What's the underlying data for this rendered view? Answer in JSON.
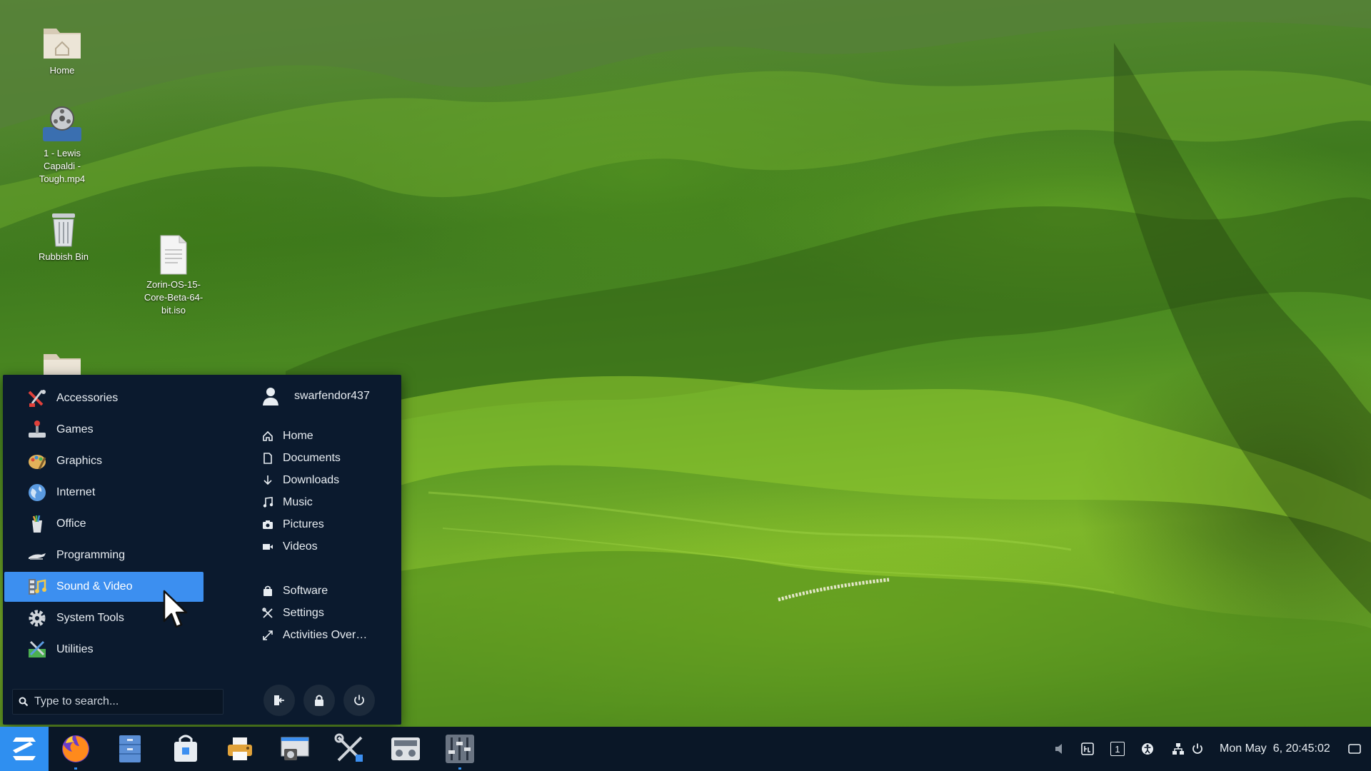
{
  "desktop": {
    "icons": [
      {
        "label": "Home",
        "icon": "home-folder-icon"
      },
      {
        "label": "1 - Lewis Capaldi - Tough.mp4",
        "icon": "video-file-icon"
      },
      {
        "label": "Rubbish Bin",
        "icon": "trash-icon"
      },
      {
        "label": "Zorin-OS-15-Core-Beta-64-bit.iso",
        "icon": "document-icon"
      },
      {
        "label": "",
        "icon": "folder-icon"
      }
    ]
  },
  "menu": {
    "categories": [
      {
        "label": "Accessories",
        "icon": "accessories-icon"
      },
      {
        "label": "Games",
        "icon": "games-icon"
      },
      {
        "label": "Graphics",
        "icon": "graphics-icon"
      },
      {
        "label": "Internet",
        "icon": "internet-globe-icon"
      },
      {
        "label": "Office",
        "icon": "office-icon"
      },
      {
        "label": "Programming",
        "icon": "programming-icon"
      },
      {
        "label": "Sound & Video",
        "icon": "sound-video-icon",
        "active": true
      },
      {
        "label": "System Tools",
        "icon": "gear-icon"
      },
      {
        "label": "Utilities",
        "icon": "utilities-icon"
      }
    ],
    "user": {
      "name": "swarfendor437",
      "icon": "user-icon"
    },
    "places": [
      {
        "label": "Home",
        "icon": "home-icon"
      },
      {
        "label": "Documents",
        "icon": "document-icon"
      },
      {
        "label": "Downloads",
        "icon": "download-icon"
      },
      {
        "label": "Music",
        "icon": "music-icon"
      },
      {
        "label": "Pictures",
        "icon": "camera-icon"
      },
      {
        "label": "Videos",
        "icon": "video-icon"
      }
    ],
    "system": [
      {
        "label": "Software",
        "icon": "software-bag-icon"
      },
      {
        "label": "Settings",
        "icon": "settings-tools-icon"
      },
      {
        "label": "Activities Over…",
        "icon": "expand-icon"
      }
    ],
    "search": {
      "placeholder": "Type to search..."
    },
    "buttons": [
      {
        "name": "logout-button",
        "icon": "logout-icon"
      },
      {
        "name": "lock-button",
        "icon": "lock-icon"
      },
      {
        "name": "power-button",
        "icon": "power-icon"
      }
    ]
  },
  "taskbar": {
    "apps": [
      {
        "name": "firefox",
        "icon": "firefox-icon"
      },
      {
        "name": "files",
        "icon": "file-manager-icon"
      },
      {
        "name": "software",
        "icon": "software-store-icon"
      },
      {
        "name": "printer",
        "icon": "printer-icon"
      },
      {
        "name": "screenshot",
        "icon": "screenshot-icon"
      },
      {
        "name": "settings",
        "icon": "tools-icon"
      },
      {
        "name": "sound-recorder",
        "icon": "recorder-icon"
      },
      {
        "name": "mixer",
        "icon": "mixer-icon"
      }
    ],
    "tray": {
      "workspace": "1",
      "clock": "Mon May  6, 20:45:02"
    },
    "accent": "#2f8ff0"
  }
}
